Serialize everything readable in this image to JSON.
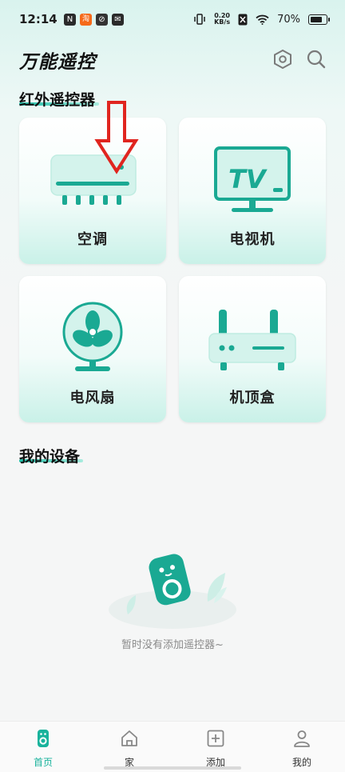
{
  "status_bar": {
    "time": "12:14",
    "notifications": [
      {
        "glyph": "N",
        "color": "#2a2a2a"
      },
      {
        "glyph": "淘",
        "color": "#f56a1a"
      },
      {
        "glyph": "⊘",
        "color": "#333333"
      },
      {
        "glyph": "✉",
        "color": "#2a2a2a"
      }
    ],
    "net_speed_value": "0.20",
    "net_speed_unit": "KB/s",
    "battery": "70%"
  },
  "header": {
    "title": "万能遥控",
    "settings_icon": "hexagon-settings-icon",
    "search_icon": "search-icon"
  },
  "ir_section": {
    "title": "红外遥控器",
    "devices": [
      {
        "label": "空调",
        "icon": "air-conditioner-icon"
      },
      {
        "label": "电视机",
        "icon": "tv-icon"
      },
      {
        "label": "电风扇",
        "icon": "fan-icon"
      },
      {
        "label": "机顶盒",
        "icon": "set-top-box-icon"
      }
    ]
  },
  "my_devices": {
    "title": "我的设备",
    "empty_text": "暂时没有添加遥控器~"
  },
  "tabbar": {
    "tabs": [
      {
        "label": "首页",
        "icon": "remote-home-icon",
        "active": true
      },
      {
        "label": "家",
        "icon": "house-icon",
        "active": false
      },
      {
        "label": "添加",
        "icon": "add-box-icon",
        "active": false
      },
      {
        "label": "我的",
        "icon": "user-icon",
        "active": false
      }
    ]
  },
  "colors": {
    "accent": "#1bb9a2",
    "active_tab": "#19b39c",
    "annotation_arrow": "#e0251f"
  }
}
